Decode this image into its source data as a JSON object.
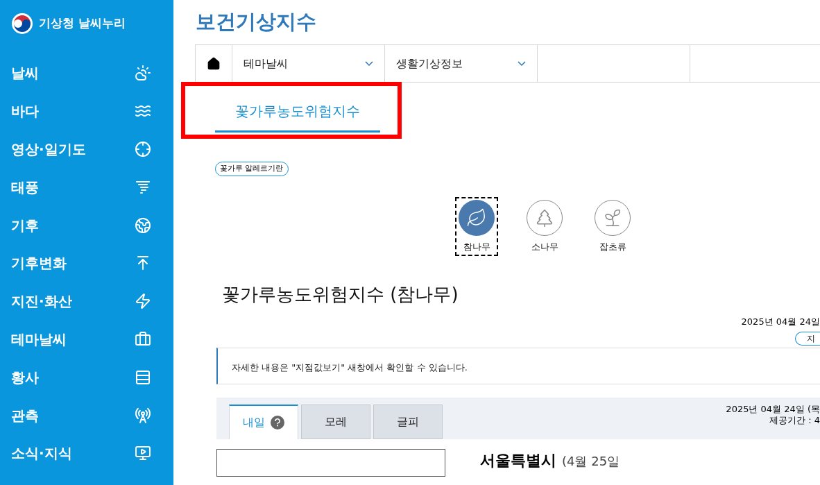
{
  "sidebar": {
    "logo_text": "기상청 날씨누리",
    "items": [
      {
        "label": "날씨"
      },
      {
        "label": "바다"
      },
      {
        "label": "영상·일기도"
      },
      {
        "label": "태풍"
      },
      {
        "label": "기후"
      },
      {
        "label": "기후변화"
      },
      {
        "label": "지진·화산"
      },
      {
        "label": "테마날씨"
      },
      {
        "label": "황사"
      },
      {
        "label": "관측"
      },
      {
        "label": "소식·지식"
      }
    ]
  },
  "page_title": "보건기상지수",
  "breadcrumb": [
    {
      "label": "테마날씨"
    },
    {
      "label": "생활기상정보"
    }
  ],
  "sub_tab": {
    "label": "꽃가루농도위험지수",
    "selected": true,
    "highlighted": true
  },
  "season_badge": "꽃가루 알레르기란",
  "pollen_types": [
    {
      "label": "참나무",
      "selected": true
    },
    {
      "label": "소나무",
      "selected": false
    },
    {
      "label": "잡초류",
      "selected": false
    }
  ],
  "heading": "꽃가루농도위험지수 (참나무)",
  "issued_date": "2025년 04월 24일",
  "right_button": "지",
  "notice": "자세한 내용은 \"지점값보기\" 새창에서 확인할 수 있습니다.",
  "day_tabs": [
    {
      "label": "내일",
      "selected": true,
      "help": true
    },
    {
      "label": "모레",
      "selected": false,
      "help": false
    },
    {
      "label": "글피",
      "selected": false,
      "help": false
    }
  ],
  "forecast_date": "2025년 04월 24일 (목",
  "period": "제공기간 : 4",
  "region_title": "서울특별시",
  "region_date": "(4월 25일"
}
